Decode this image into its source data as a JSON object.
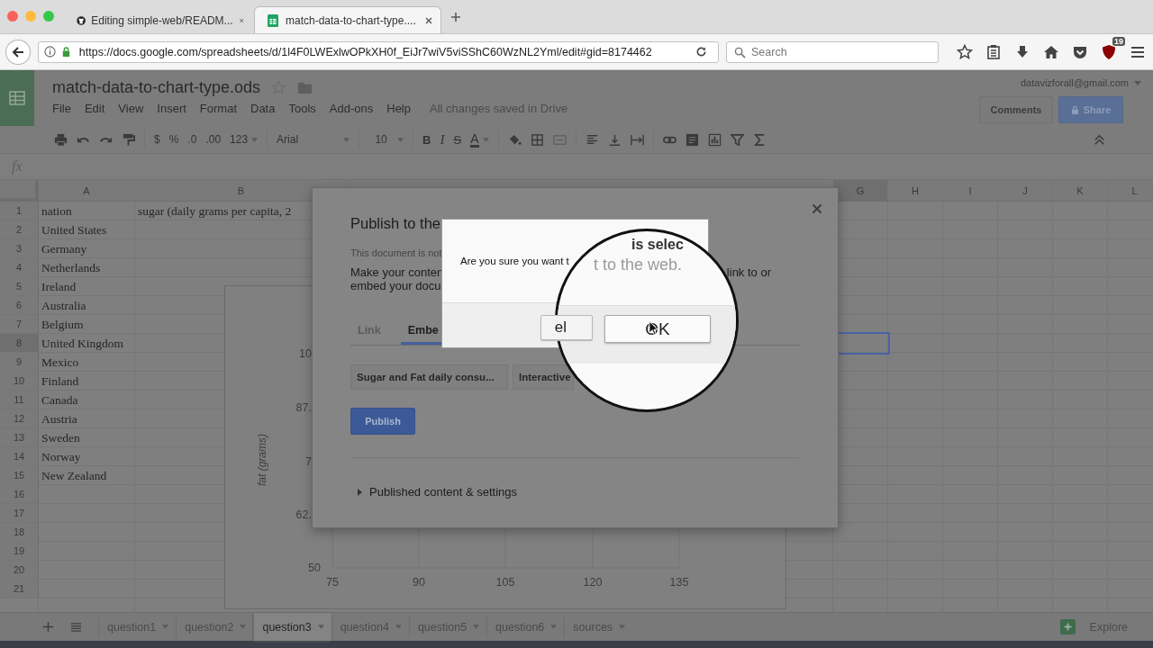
{
  "browser": {
    "tabs": [
      {
        "title": "Editing simple-web/READM...",
        "selected": false
      },
      {
        "title": "match-data-to-chart-type....",
        "selected": true
      }
    ],
    "url": "https://docs.google.com/spreadsheets/d/1l4F0LWExlwOPkXH0f_EiJr7wiV5viSShC60WzNL2Yml/edit#gid=8174462",
    "search": {
      "placeholder": "Search"
    },
    "badge": "19"
  },
  "doc": {
    "title": "match-data-to-chart-type.ods",
    "account": "datavizforall@gmail.com",
    "menu": [
      "File",
      "Edit",
      "View",
      "Insert",
      "Format",
      "Data",
      "Tools",
      "Add-ons",
      "Help"
    ],
    "save_status": "All changes saved in Drive",
    "comments": "Comments",
    "share": "Share"
  },
  "toolbar": {
    "currency": "$",
    "percent": "%",
    "decrease_decimals": ".0",
    "increase_decimals": ".00",
    "number_format": "123",
    "font": "Arial",
    "size": "10",
    "bold": "B",
    "italic": "I",
    "strike": "S",
    "text_color": "A"
  },
  "formula_bar": {
    "label": "fx"
  },
  "grid": {
    "columns": [
      {
        "label": "A",
        "selected": false
      },
      {
        "label": "B",
        "selected": false
      },
      {
        "label": "G",
        "selected": true
      },
      {
        "label": "H",
        "selected": false
      },
      {
        "label": "I",
        "selected": false
      },
      {
        "label": "J",
        "selected": false
      },
      {
        "label": "K",
        "selected": false
      },
      {
        "label": "L",
        "selected": false
      }
    ],
    "rows": [
      {
        "number": "1",
        "selected": false,
        "cells": [
          "nation",
          "sugar (daily grams per capita, 2"
        ]
      },
      {
        "number": "2",
        "selected": false,
        "cells": [
          "United States"
        ]
      },
      {
        "number": "3",
        "selected": false,
        "cells": [
          "Germany"
        ]
      },
      {
        "number": "4",
        "selected": false,
        "cells": [
          "Netherlands"
        ]
      },
      {
        "number": "5",
        "selected": false,
        "cells": [
          "Ireland"
        ]
      },
      {
        "number": "6",
        "selected": false,
        "cells": [
          "Australia"
        ]
      },
      {
        "number": "7",
        "selected": false,
        "cells": [
          "Belgium"
        ]
      },
      {
        "number": "8",
        "selected": true,
        "cells": [
          "United Kingdom"
        ]
      },
      {
        "number": "9",
        "selected": false,
        "cells": [
          "Mexico"
        ]
      },
      {
        "number": "10",
        "selected": false,
        "cells": [
          "Finland"
        ]
      },
      {
        "number": "11",
        "selected": false,
        "cells": [
          "Canada"
        ]
      },
      {
        "number": "12",
        "selected": false,
        "cells": [
          "Austria"
        ]
      },
      {
        "number": "13",
        "selected": false,
        "cells": [
          "Sweden"
        ]
      },
      {
        "number": "14",
        "selected": false,
        "cells": [
          "Norway"
        ]
      },
      {
        "number": "15",
        "selected": false,
        "cells": [
          "New Zealand"
        ]
      },
      {
        "number": "16",
        "selected": false
      },
      {
        "number": "17",
        "selected": false
      },
      {
        "number": "18",
        "selected": false
      },
      {
        "number": "19",
        "selected": false
      },
      {
        "number": "20",
        "selected": false
      },
      {
        "number": "21",
        "selected": false
      }
    ],
    "chart": {
      "ylabel": "fat (grams)",
      "y_tick_labels": [
        "10",
        "87.",
        "7",
        "62.",
        "50"
      ],
      "x_tick_labels": [
        "75",
        "90",
        "105",
        "120",
        "135"
      ]
    }
  },
  "publish_dialog": {
    "title": "Publish to the",
    "notice": "This document is not",
    "description_lines": [
      "Make your conten",
      "embed your docu"
    ],
    "description_end": "link to or",
    "tabs": [
      {
        "label": "Link",
        "selected": false
      },
      {
        "label": "Embe",
        "selected": true
      }
    ],
    "selects": [
      "Sugar and Fat daily consu...",
      "Interactive"
    ],
    "publish": "Publish",
    "section": "Published content & settings"
  },
  "confirm_dialog": {
    "message": "Are you sure you want t",
    "cancel": "el"
  },
  "magnifier": {
    "heading": "is selec",
    "faint_text": "t to the web.",
    "ok": "OK"
  },
  "sheet_tabs": [
    {
      "label": "question1",
      "selected": false
    },
    {
      "label": "question2",
      "selected": false
    },
    {
      "label": "question3",
      "selected": true
    },
    {
      "label": "question4",
      "selected": false
    },
    {
      "label": "question5",
      "selected": false
    },
    {
      "label": "question6",
      "selected": false
    },
    {
      "label": "sources",
      "selected": false
    }
  ],
  "explore": "Explore"
}
